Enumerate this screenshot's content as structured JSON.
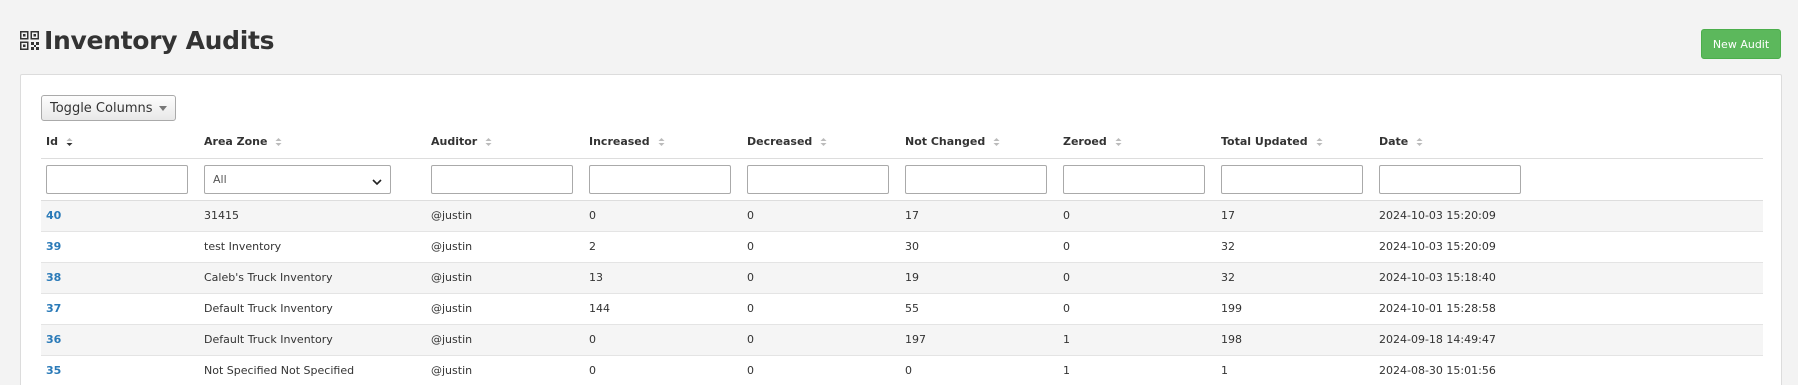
{
  "page": {
    "title": "Inventory Audits",
    "title_icon": "qrcode-icon",
    "new_audit_label": "New Audit"
  },
  "toolbar": {
    "toggle_columns_label": "Toggle Columns"
  },
  "table": {
    "columns": [
      "Id",
      "Area Zone",
      "Auditor",
      "Increased",
      "Decreased",
      "Not Changed",
      "Zeroed",
      "Total Updated",
      "Date"
    ],
    "area_zone_filter_value": "All",
    "rows": [
      {
        "id": "40",
        "area_zone": "31415",
        "auditor": "@justin",
        "increased": "0",
        "decreased": "0",
        "not_changed": "17",
        "zeroed": "0",
        "total_updated": "17",
        "date": "2024-10-03 15:20:09"
      },
      {
        "id": "39",
        "area_zone": "test Inventory",
        "auditor": "@justin",
        "increased": "2",
        "decreased": "0",
        "not_changed": "30",
        "zeroed": "0",
        "total_updated": "32",
        "date": "2024-10-03 15:20:09"
      },
      {
        "id": "38",
        "area_zone": "Caleb's Truck Inventory",
        "auditor": "@justin",
        "increased": "13",
        "decreased": "0",
        "not_changed": "19",
        "zeroed": "0",
        "total_updated": "32",
        "date": "2024-10-03 15:18:40"
      },
      {
        "id": "37",
        "area_zone": "Default Truck Inventory",
        "auditor": "@justin",
        "increased": "144",
        "decreased": "0",
        "not_changed": "55",
        "zeroed": "0",
        "total_updated": "199",
        "date": "2024-10-01 15:28:58"
      },
      {
        "id": "36",
        "area_zone": "Default Truck Inventory",
        "auditor": "@justin",
        "increased": "0",
        "decreased": "0",
        "not_changed": "197",
        "zeroed": "1",
        "total_updated": "198",
        "date": "2024-09-18 14:49:47"
      },
      {
        "id": "35",
        "area_zone": "Not Specified Not Specified",
        "auditor": "@justin",
        "increased": "0",
        "decreased": "0",
        "not_changed": "0",
        "zeroed": "1",
        "total_updated": "1",
        "date": "2024-08-30 15:01:56"
      }
    ]
  },
  "colors": {
    "primary_link": "#2a7ab8",
    "success_button": "#5cb85c"
  }
}
